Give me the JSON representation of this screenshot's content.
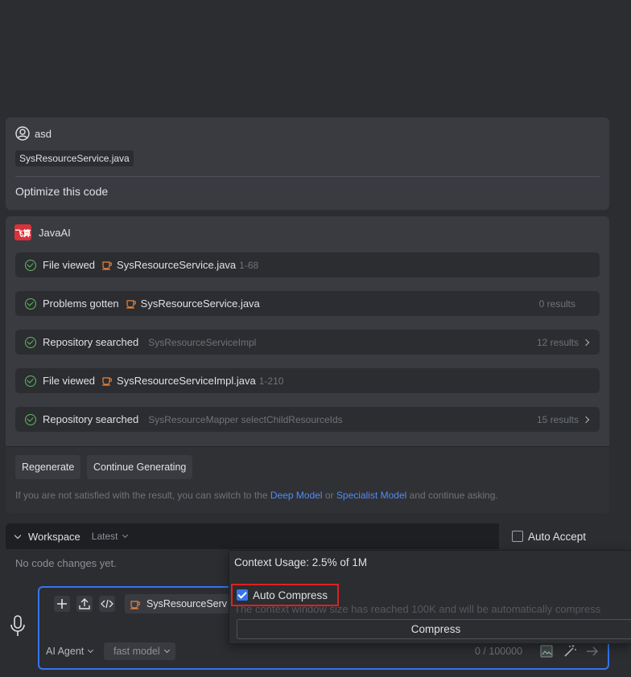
{
  "user_message": {
    "username": "asd",
    "attached_file": "SysResourceService.java",
    "prompt": "Optimize this code"
  },
  "ai_message": {
    "name": "JavaAI",
    "logo_text": "飞算",
    "steps": [
      {
        "title": "File viewed",
        "file": "SysResourceService.java",
        "detail": "1-68",
        "right": ""
      },
      {
        "title": "Problems gotten",
        "file": "SysResourceService.java",
        "detail": "",
        "right": "0 results"
      },
      {
        "title": "Repository searched",
        "file": "",
        "detail": "SysResourceServiceImpl",
        "right": "12 results"
      },
      {
        "title": "File viewed",
        "file": "SysResourceServiceImpl.java",
        "detail": "1-210",
        "right": ""
      },
      {
        "title": "Repository searched",
        "file": "",
        "detail": "SysResourceMapper selectChildResourceIds",
        "right": "15 results"
      }
    ],
    "regenerate_label": "Regenerate",
    "continue_label": "Continue Generating",
    "hint_prefix": "If you are not satisfied with the result, you can switch to the",
    "deep_model": "Deep Model",
    "hint_or": "or",
    "specialist_model": "Specialist Model",
    "hint_suffix": "and continue asking."
  },
  "workspace": {
    "title": "Workspace",
    "version": "Latest",
    "auto_accept": "Auto Accept",
    "empty": "No code changes yet."
  },
  "input": {
    "attached_file": "SysResourceServ",
    "agent": "AI Agent",
    "model": "fast model",
    "counter": "0 / 100000"
  },
  "popup": {
    "context_usage": "Context Usage: 2.5% of 1M",
    "auto_compress": "Auto Compress",
    "auto_compress_checked": true,
    "note": "The context window size has reached 100K and will be automatically compress",
    "compress_button": "Compress"
  },
  "colors": {
    "accent": "#3574f0",
    "success": "#5fb865",
    "highlight_border": "#e02020",
    "link": "#548af7"
  }
}
